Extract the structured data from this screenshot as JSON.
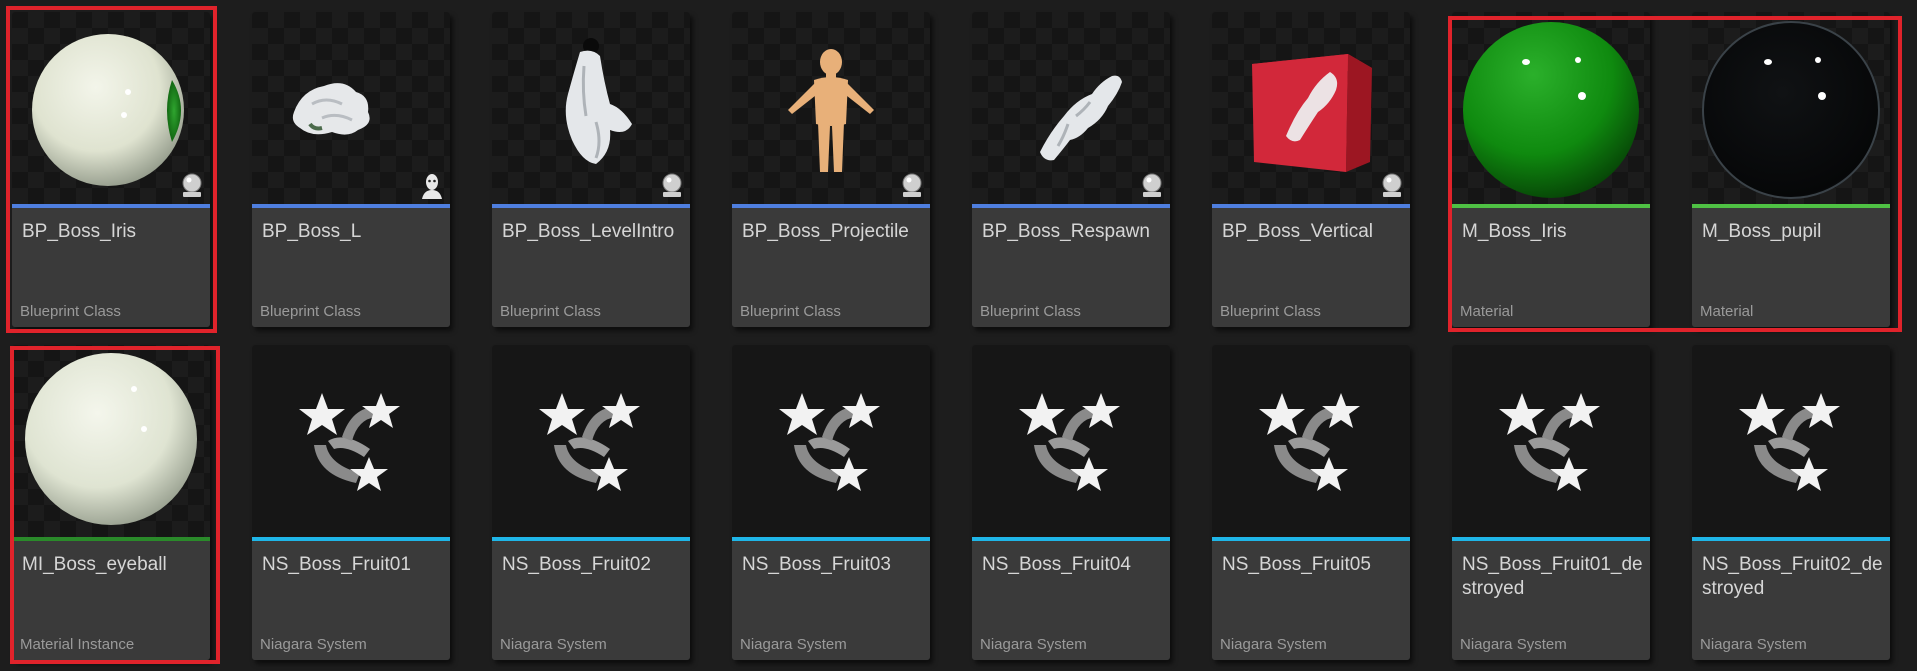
{
  "colors": {
    "blueprint_stripe": "#4f7fe0",
    "material_stripe": "#4fc144",
    "material_instance_stripe": "#2a8a2a",
    "niagara_stripe": "#1fb6e8",
    "selection_highlight": "#e0232b"
  },
  "assets": [
    {
      "name": "BP_Boss_Iris",
      "type": "Blueprint Class",
      "thumb": "eyeball-with-iris",
      "badge": "actor-badge-icon"
    },
    {
      "name": "BP_Boss_L",
      "type": "Blueprint Class",
      "thumb": "crumpled-glove",
      "badge": "character-badge-icon"
    },
    {
      "name": "BP_Boss_LevelIntro",
      "type": "Blueprint Class",
      "thumb": "pointing-glove-hand",
      "badge": "actor-badge-icon"
    },
    {
      "name": "BP_Boss_Projectile",
      "type": "Blueprint Class",
      "thumb": "mannequin-figure",
      "badge": "actor-badge-icon"
    },
    {
      "name": "BP_Boss_Respawn",
      "type": "Blueprint Class",
      "thumb": "glove-hand",
      "badge": "actor-badge-icon"
    },
    {
      "name": "BP_Boss_Vertical",
      "type": "Blueprint Class",
      "thumb": "red-cube-with-glove",
      "badge": "actor-badge-icon"
    },
    {
      "name": "M_Boss_Iris",
      "type": "Material",
      "thumb": "green-glossy-sphere"
    },
    {
      "name": "M_Boss_pupil",
      "type": "Material",
      "thumb": "black-glossy-sphere"
    },
    {
      "name": "MI_Boss_eyeball",
      "type": "Material Instance",
      "thumb": "white-sphere"
    },
    {
      "name": "NS_Boss_Fruit01",
      "type": "Niagara System",
      "thumb": "niagara-stars-icon"
    },
    {
      "name": "NS_Boss_Fruit02",
      "type": "Niagara System",
      "thumb": "niagara-stars-icon"
    },
    {
      "name": "NS_Boss_Fruit03",
      "type": "Niagara System",
      "thumb": "niagara-stars-icon"
    },
    {
      "name": "NS_Boss_Fruit04",
      "type": "Niagara System",
      "thumb": "niagara-stars-icon"
    },
    {
      "name": "NS_Boss_Fruit05",
      "type": "Niagara System",
      "thumb": "niagara-stars-icon"
    },
    {
      "name": "NS_Boss_Fruit01_destroyed",
      "type": "Niagara System",
      "thumb": "niagara-stars-icon"
    },
    {
      "name": "NS_Boss_Fruit02_destroyed",
      "type": "Niagara System",
      "thumb": "niagara-stars-icon"
    }
  ]
}
